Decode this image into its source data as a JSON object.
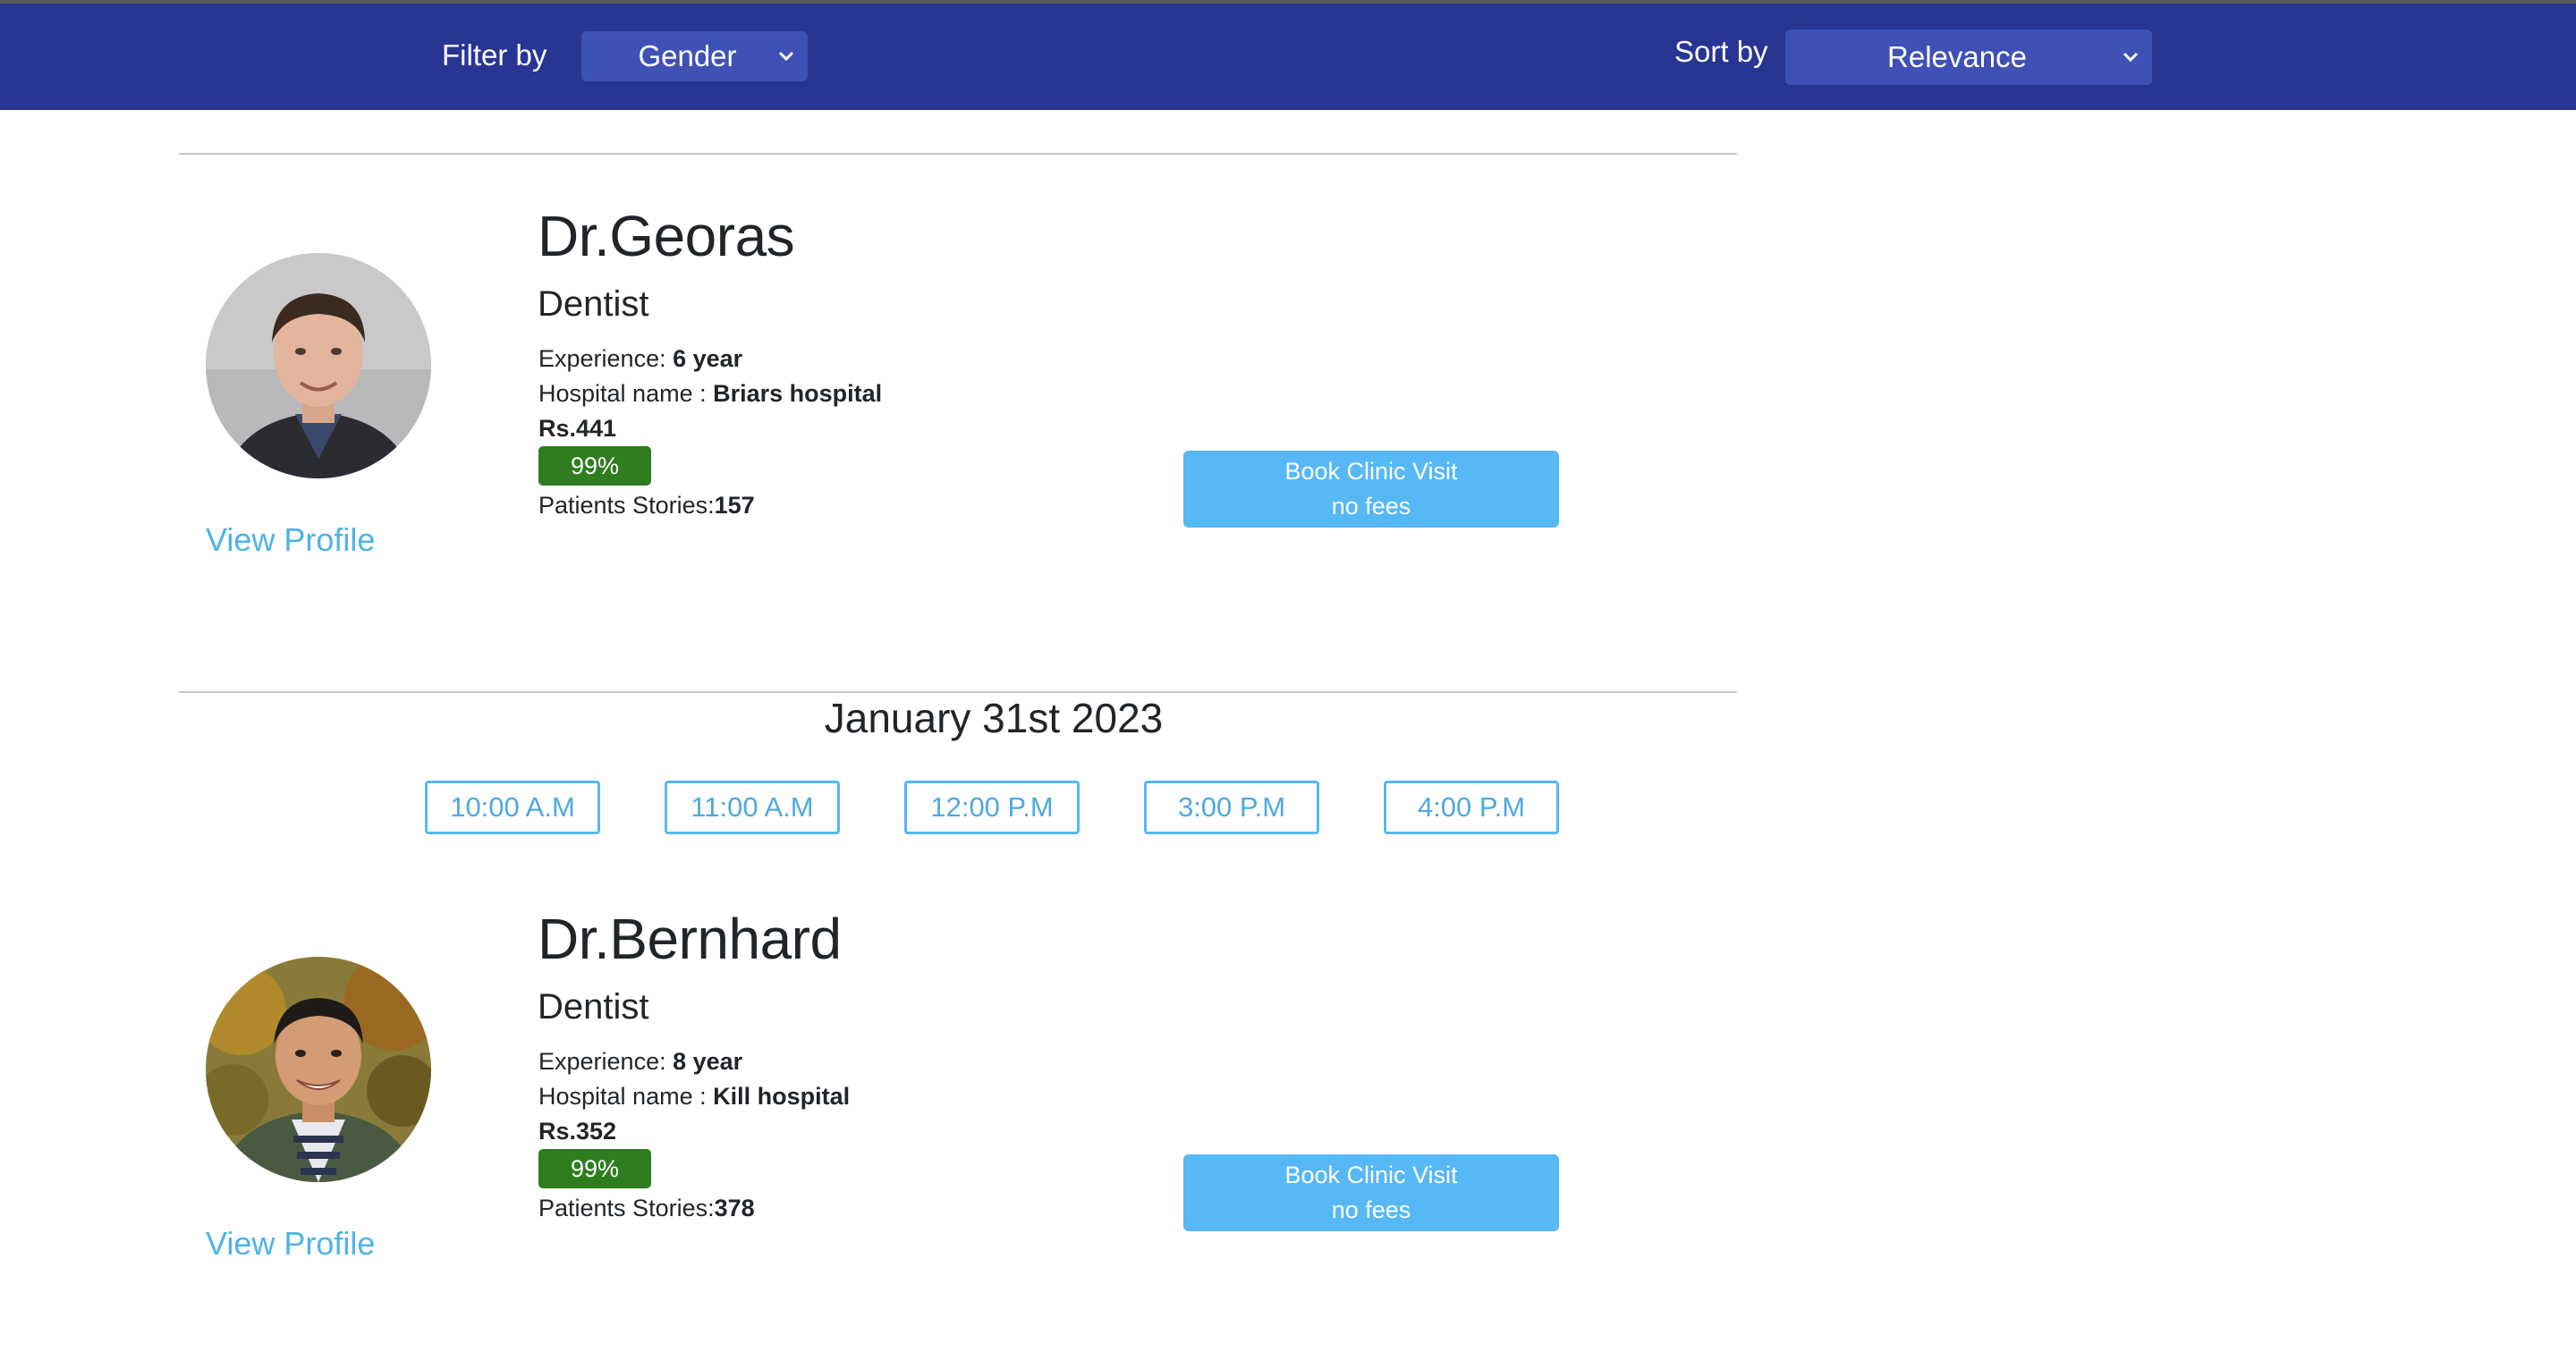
{
  "toolbar": {
    "filter_label": "Filter by",
    "filter_value": "Gender",
    "sort_label": "Sort by",
    "sort_value": "Relevance"
  },
  "colors": {
    "bar": "#283593",
    "select_bg": "#3f51b5",
    "link": "#4fb3e6",
    "button": "#56b8f4",
    "rating_badge": "#2e7d1f"
  },
  "doctors": [
    {
      "name": "Dr.Georas",
      "specialty": "Dentist",
      "experience_label": "Experience: ",
      "experience": "6 year",
      "hospital_label": "Hospital name : ",
      "hospital": "Briars hospital",
      "fee": "Rs.441",
      "rating": "99%",
      "stories_label": "Patients Stories:",
      "stories": "157",
      "view_profile": "View Profile",
      "book_line1": "Book Clinic Visit",
      "book_line2": "no fees"
    },
    {
      "name": "Dr.Bernhard",
      "specialty": "Dentist",
      "experience_label": "Experience: ",
      "experience": "8 year",
      "hospital_label": "Hospital name : ",
      "hospital": "Kill hospital",
      "fee": "Rs.352",
      "rating": "99%",
      "stories_label": "Patients Stories:",
      "stories": "378",
      "view_profile": "View Profile",
      "book_line1": "Book Clinic Visit",
      "book_line2": "no fees"
    }
  ],
  "schedule": {
    "date": "January 31st 2023",
    "slots": [
      "10:00 A.M",
      "11:00 A.M",
      "12:00 P.M",
      "3:00 P.M",
      "4:00 P.M"
    ]
  }
}
